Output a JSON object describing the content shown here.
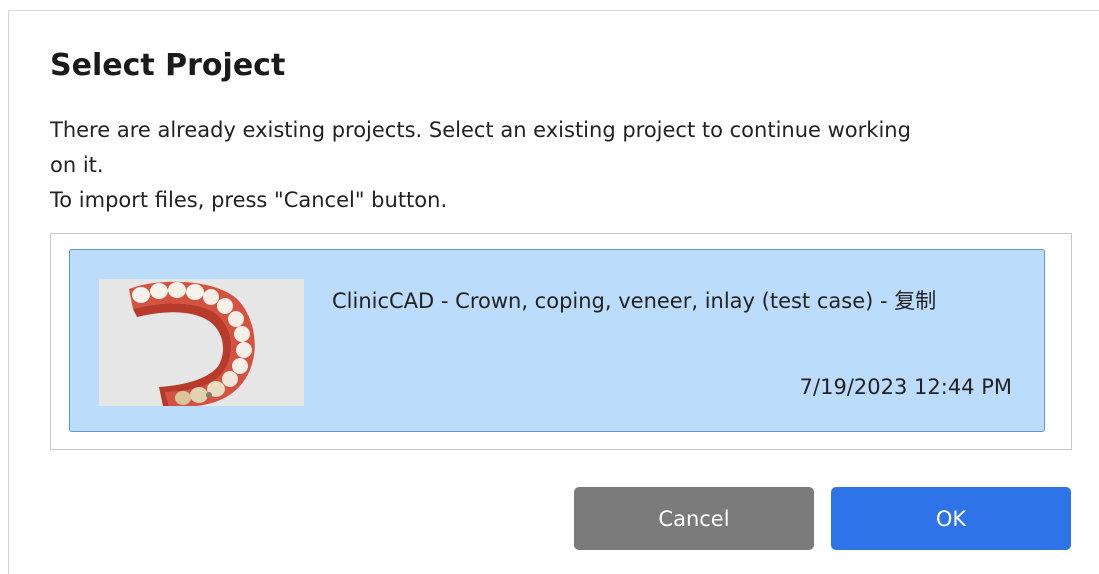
{
  "dialog": {
    "title": "Select Project",
    "message_line1": "There are already existing projects. Select an existing project to continue working",
    "message_line2": "on it.",
    "message_line3": "To import files, press \"Cancel\" button."
  },
  "projects": [
    {
      "name": "ClinicCAD - Crown, coping, veneer, inlay (test case) - 复制",
      "date": "7/19/2023 12:44 PM",
      "selected": true,
      "thumbnail": "dental-arch-scan-thumbnail"
    }
  ],
  "buttons": {
    "cancel_label": "Cancel",
    "ok_label": "OK"
  },
  "colors": {
    "selected_item_bg": "#bcdcfb",
    "selected_item_border": "#5f93d6",
    "cancel_bg": "#7b7b7b",
    "ok_bg": "#2e73e8"
  }
}
